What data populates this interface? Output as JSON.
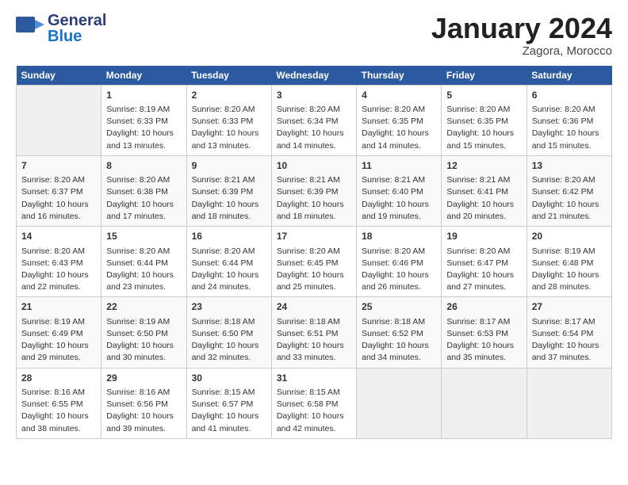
{
  "logo": {
    "line1": "General",
    "line2": "Blue",
    "icon": "▶"
  },
  "title": "January 2024",
  "subtitle": "Zagora, Morocco",
  "columns": [
    "Sunday",
    "Monday",
    "Tuesday",
    "Wednesday",
    "Thursday",
    "Friday",
    "Saturday"
  ],
  "weeks": [
    [
      {
        "day": "",
        "info": ""
      },
      {
        "day": "1",
        "info": "Sunrise: 8:19 AM\nSunset: 6:33 PM\nDaylight: 10 hours\nand 13 minutes."
      },
      {
        "day": "2",
        "info": "Sunrise: 8:20 AM\nSunset: 6:33 PM\nDaylight: 10 hours\nand 13 minutes."
      },
      {
        "day": "3",
        "info": "Sunrise: 8:20 AM\nSunset: 6:34 PM\nDaylight: 10 hours\nand 14 minutes."
      },
      {
        "day": "4",
        "info": "Sunrise: 8:20 AM\nSunset: 6:35 PM\nDaylight: 10 hours\nand 14 minutes."
      },
      {
        "day": "5",
        "info": "Sunrise: 8:20 AM\nSunset: 6:35 PM\nDaylight: 10 hours\nand 15 minutes."
      },
      {
        "day": "6",
        "info": "Sunrise: 8:20 AM\nSunset: 6:36 PM\nDaylight: 10 hours\nand 15 minutes."
      }
    ],
    [
      {
        "day": "7",
        "info": "Sunrise: 8:20 AM\nSunset: 6:37 PM\nDaylight: 10 hours\nand 16 minutes."
      },
      {
        "day": "8",
        "info": "Sunrise: 8:20 AM\nSunset: 6:38 PM\nDaylight: 10 hours\nand 17 minutes."
      },
      {
        "day": "9",
        "info": "Sunrise: 8:21 AM\nSunset: 6:39 PM\nDaylight: 10 hours\nand 18 minutes."
      },
      {
        "day": "10",
        "info": "Sunrise: 8:21 AM\nSunset: 6:39 PM\nDaylight: 10 hours\nand 18 minutes."
      },
      {
        "day": "11",
        "info": "Sunrise: 8:21 AM\nSunset: 6:40 PM\nDaylight: 10 hours\nand 19 minutes."
      },
      {
        "day": "12",
        "info": "Sunrise: 8:21 AM\nSunset: 6:41 PM\nDaylight: 10 hours\nand 20 minutes."
      },
      {
        "day": "13",
        "info": "Sunrise: 8:20 AM\nSunset: 6:42 PM\nDaylight: 10 hours\nand 21 minutes."
      }
    ],
    [
      {
        "day": "14",
        "info": "Sunrise: 8:20 AM\nSunset: 6:43 PM\nDaylight: 10 hours\nand 22 minutes."
      },
      {
        "day": "15",
        "info": "Sunrise: 8:20 AM\nSunset: 6:44 PM\nDaylight: 10 hours\nand 23 minutes."
      },
      {
        "day": "16",
        "info": "Sunrise: 8:20 AM\nSunset: 6:44 PM\nDaylight: 10 hours\nand 24 minutes."
      },
      {
        "day": "17",
        "info": "Sunrise: 8:20 AM\nSunset: 6:45 PM\nDaylight: 10 hours\nand 25 minutes."
      },
      {
        "day": "18",
        "info": "Sunrise: 8:20 AM\nSunset: 6:46 PM\nDaylight: 10 hours\nand 26 minutes."
      },
      {
        "day": "19",
        "info": "Sunrise: 8:20 AM\nSunset: 6:47 PM\nDaylight: 10 hours\nand 27 minutes."
      },
      {
        "day": "20",
        "info": "Sunrise: 8:19 AM\nSunset: 6:48 PM\nDaylight: 10 hours\nand 28 minutes."
      }
    ],
    [
      {
        "day": "21",
        "info": "Sunrise: 8:19 AM\nSunset: 6:49 PM\nDaylight: 10 hours\nand 29 minutes."
      },
      {
        "day": "22",
        "info": "Sunrise: 8:19 AM\nSunset: 6:50 PM\nDaylight: 10 hours\nand 30 minutes."
      },
      {
        "day": "23",
        "info": "Sunrise: 8:18 AM\nSunset: 6:50 PM\nDaylight: 10 hours\nand 32 minutes."
      },
      {
        "day": "24",
        "info": "Sunrise: 8:18 AM\nSunset: 6:51 PM\nDaylight: 10 hours\nand 33 minutes."
      },
      {
        "day": "25",
        "info": "Sunrise: 8:18 AM\nSunset: 6:52 PM\nDaylight: 10 hours\nand 34 minutes."
      },
      {
        "day": "26",
        "info": "Sunrise: 8:17 AM\nSunset: 6:53 PM\nDaylight: 10 hours\nand 35 minutes."
      },
      {
        "day": "27",
        "info": "Sunrise: 8:17 AM\nSunset: 6:54 PM\nDaylight: 10 hours\nand 37 minutes."
      }
    ],
    [
      {
        "day": "28",
        "info": "Sunrise: 8:16 AM\nSunset: 6:55 PM\nDaylight: 10 hours\nand 38 minutes."
      },
      {
        "day": "29",
        "info": "Sunrise: 8:16 AM\nSunset: 6:56 PM\nDaylight: 10 hours\nand 39 minutes."
      },
      {
        "day": "30",
        "info": "Sunrise: 8:15 AM\nSunset: 6:57 PM\nDaylight: 10 hours\nand 41 minutes."
      },
      {
        "day": "31",
        "info": "Sunrise: 8:15 AM\nSunset: 6:58 PM\nDaylight: 10 hours\nand 42 minutes."
      },
      {
        "day": "",
        "info": ""
      },
      {
        "day": "",
        "info": ""
      },
      {
        "day": "",
        "info": ""
      }
    ]
  ]
}
